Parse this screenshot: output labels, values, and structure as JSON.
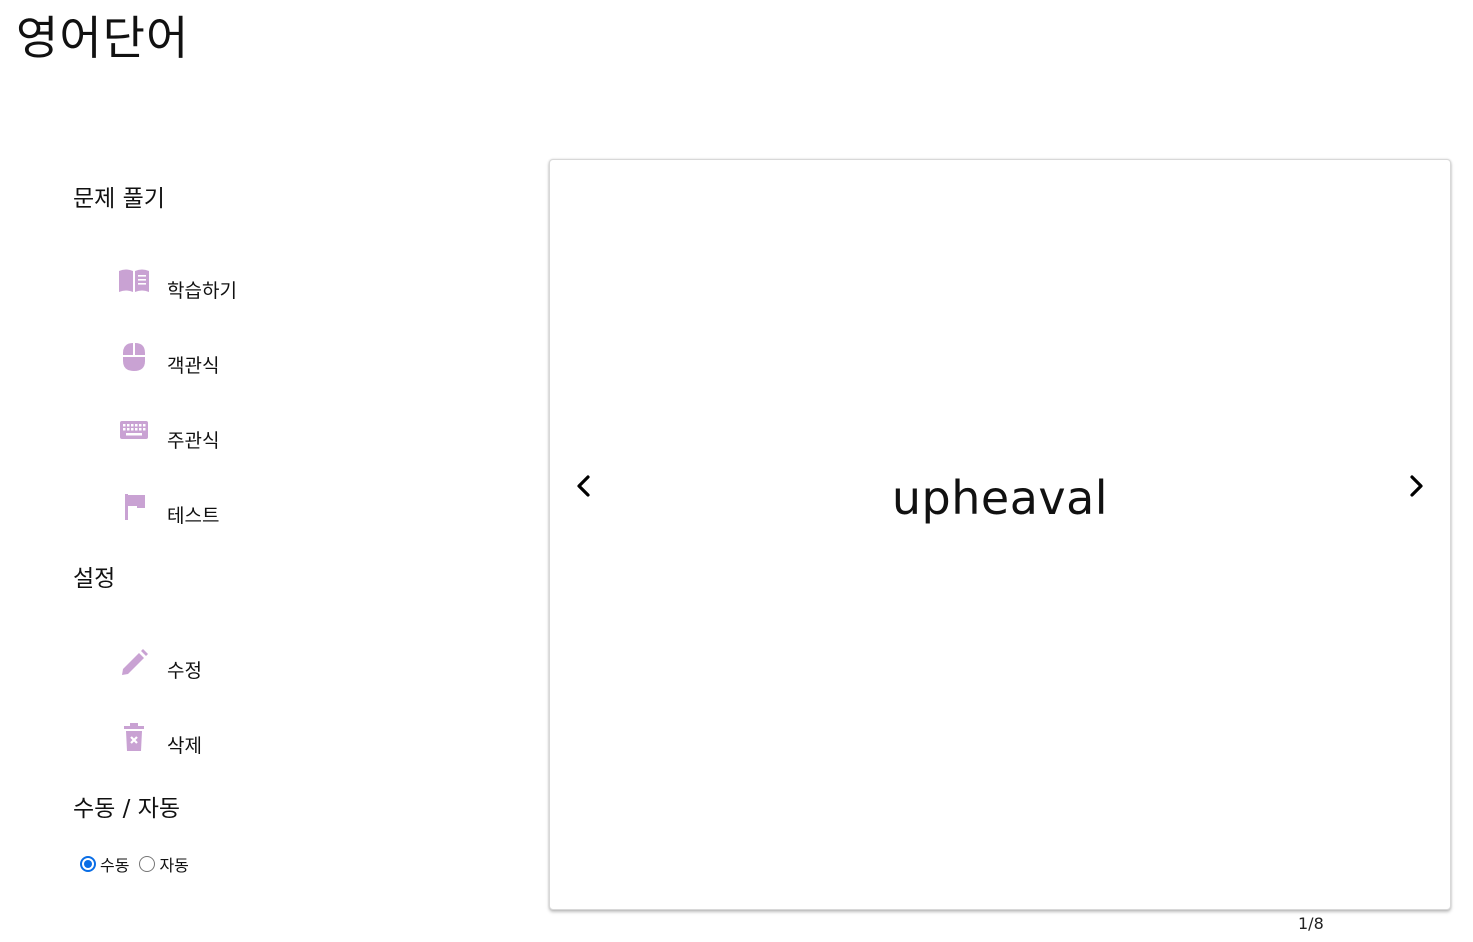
{
  "app": {
    "title": "영어단어"
  },
  "sidebar": {
    "practice_section": {
      "title": "문제 풀기",
      "items": [
        {
          "label": "학습하기",
          "icon": "book-open-icon"
        },
        {
          "label": "객관식",
          "icon": "mouse-icon"
        },
        {
          "label": "주관식",
          "icon": "keyboard-icon"
        },
        {
          "label": "테스트",
          "icon": "flag-icon"
        }
      ]
    },
    "settings_section": {
      "title": "설정",
      "items": [
        {
          "label": "수정",
          "icon": "pencil-icon"
        },
        {
          "label": "삭제",
          "icon": "trash-icon"
        }
      ]
    },
    "mode_section": {
      "title": "수동 / 자동",
      "options": [
        {
          "label": "수동",
          "checked": true
        },
        {
          "label": "자동",
          "checked": false
        }
      ]
    }
  },
  "flashcard": {
    "word": "upheaval",
    "counter": "1/8"
  },
  "colors": {
    "icon": "#c9a2d3",
    "radio_checked": "#0a6ee6"
  }
}
